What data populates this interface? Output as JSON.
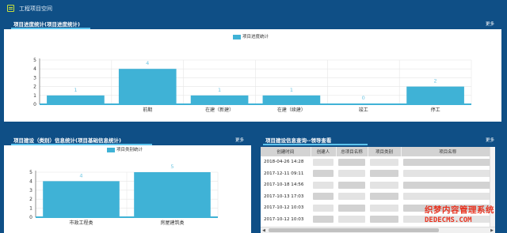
{
  "header": {
    "title": "工程项目空间"
  },
  "panel1": {
    "title": "项目进度统计(项目进度统计)",
    "more": "更多",
    "legend": "项目进度统计"
  },
  "panel2": {
    "title": "项目建设（类别）信息统计(项目基础信息统计)",
    "more": "更多",
    "legend": "项目类别统计"
  },
  "panel3": {
    "title": "项目建设信息查询--领导查看",
    "more": "更多",
    "columns": [
      "创建时间",
      "创建人",
      "总项目名称",
      "项目类别",
      "项目名称"
    ],
    "rows": [
      "2018-04-26 14:28",
      "2017-12-11 09:11",
      "2017-10-18 14:56",
      "2017-10-13 17:03",
      "2017-10-12 10:03",
      "2017-10-12 10:03",
      "2017-10-12 10:02"
    ]
  },
  "watermark": {
    "line1": "织梦内容管理系统",
    "line2": "DEDECMS.COM"
  },
  "chart_data": [
    {
      "type": "bar",
      "categories": [
        "",
        "前期",
        "在建（新建）",
        "在建（续建）",
        "竣工",
        "停工"
      ],
      "values": [
        1,
        4,
        1,
        1,
        0,
        2
      ],
      "ylim": [
        0,
        5
      ],
      "yticks": [
        0,
        1,
        2,
        3,
        4,
        5
      ],
      "legend": "项目进度统计",
      "color": "#3fb2d6",
      "label_color": "#6fc6e3",
      "grid": true
    },
    {
      "type": "bar",
      "categories": [
        "市政工程类",
        "房屋建筑类"
      ],
      "values": [
        4,
        5
      ],
      "ylim": [
        0,
        5
      ],
      "yticks": [
        0,
        1,
        2,
        3,
        4,
        5
      ],
      "legend": "项目类别统计",
      "color": "#3fb2d6",
      "label_color": "#6fc6e3",
      "grid": true
    }
  ]
}
